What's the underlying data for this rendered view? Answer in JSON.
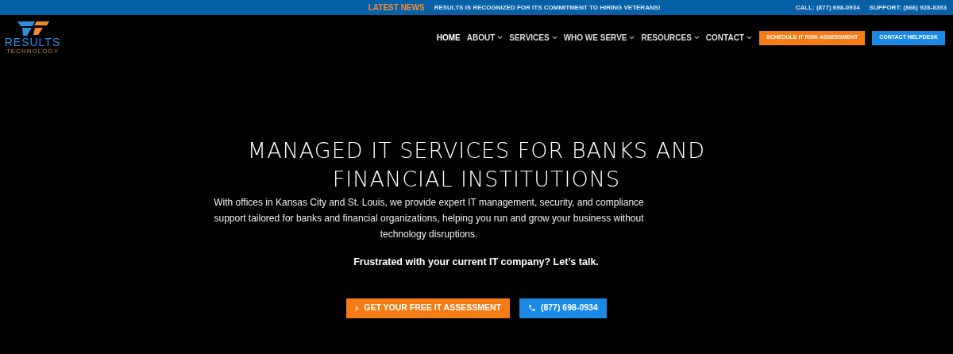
{
  "top_bar": {
    "news_label": "LATEST NEWS",
    "news_text": "RESULTS IS RECOGNIZED FOR ITS COMMITMENT TO HIRING VETERANS!",
    "contacts": [
      "CALL: (877) 698-0934",
      "SUPPORT: (866) 928-8393"
    ]
  },
  "logo": {
    "name": "RESULTS",
    "tagline": "TECHNOLOGY"
  },
  "nav": [
    {
      "label": "HOME",
      "has_menu": false
    },
    {
      "label": "ABOUT",
      "has_menu": true
    },
    {
      "label": "SERVICES",
      "has_menu": true
    },
    {
      "label": "WHO WE SERVE",
      "has_menu": true
    },
    {
      "label": "RESOURCES",
      "has_menu": true
    },
    {
      "label": "CONTACT",
      "has_menu": true
    }
  ],
  "header_buttons": [
    {
      "label": "SCHEDULE IT RISK ASSESSMENT",
      "color": "#f57c14"
    },
    {
      "label": "CONTACT HELPDESK",
      "color": "#1a8ae6"
    }
  ],
  "hero": {
    "title": "MANAGED IT SERVICES FOR BANKS AND FINANCIAL INSTITUTIONS",
    "text": "With offices in Kansas City and St. Louis, we provide expert IT management, security, and compliance support tailored for banks and financial organizations, helping you run and grow your business without technology disruptions.",
    "tagline": "Frustrated with your current IT company? Let’s talk.",
    "buttons": [
      {
        "label": "GET YOUR FREE IT ASSESSMENT",
        "kind": "arrow",
        "color": "#f57c14"
      },
      {
        "label": "(877) 698-0934",
        "kind": "phone",
        "color": "#1a8ae6"
      }
    ]
  }
}
